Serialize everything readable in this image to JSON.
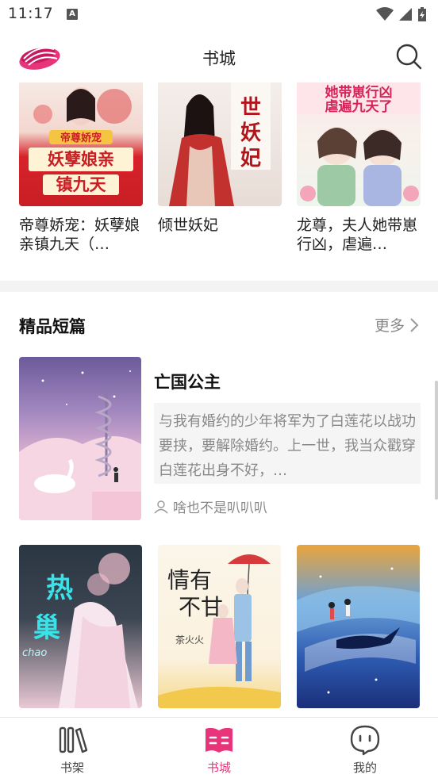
{
  "status": {
    "time": "11:17",
    "notif": "A"
  },
  "header": {
    "title": "书城"
  },
  "top_books": [
    {
      "title": "帝尊娇宠：妖孽娘亲镇九天（…",
      "cover_text": "帝尊娇宠 妖孽娘亲 镇九天"
    },
    {
      "title": "倾世妖妃",
      "cover_text": "倾世妖妃"
    },
    {
      "title": "龙尊，夫人她带崽行凶，虐遍…",
      "cover_text": "夫人她带崽行凶 虐遍九天了"
    }
  ],
  "section": {
    "title": "精品短篇",
    "more": "更多"
  },
  "featured": {
    "title": "亡国公主",
    "description": "与我有婚约的少年将军为了白莲花以战功要挟，要解除婚约。上一世，我当众戳穿白莲花出身不好，…",
    "author": "啥也不是叭叭叭"
  },
  "bottom_books": [
    {
      "cover_text": "热巢",
      "cover_sub": "chao"
    },
    {
      "cover_text": "情有不甘",
      "cover_sub": "茶火火"
    },
    {
      "cover_text": ""
    }
  ],
  "nav": {
    "items": [
      {
        "label": "书架",
        "icon": "bookshelf-icon"
      },
      {
        "label": "书城",
        "icon": "bookstore-icon"
      },
      {
        "label": "我的",
        "icon": "profile-icon"
      }
    ]
  },
  "colors": {
    "accent": "#e8347a",
    "text": "#222222",
    "muted": "#888888"
  }
}
